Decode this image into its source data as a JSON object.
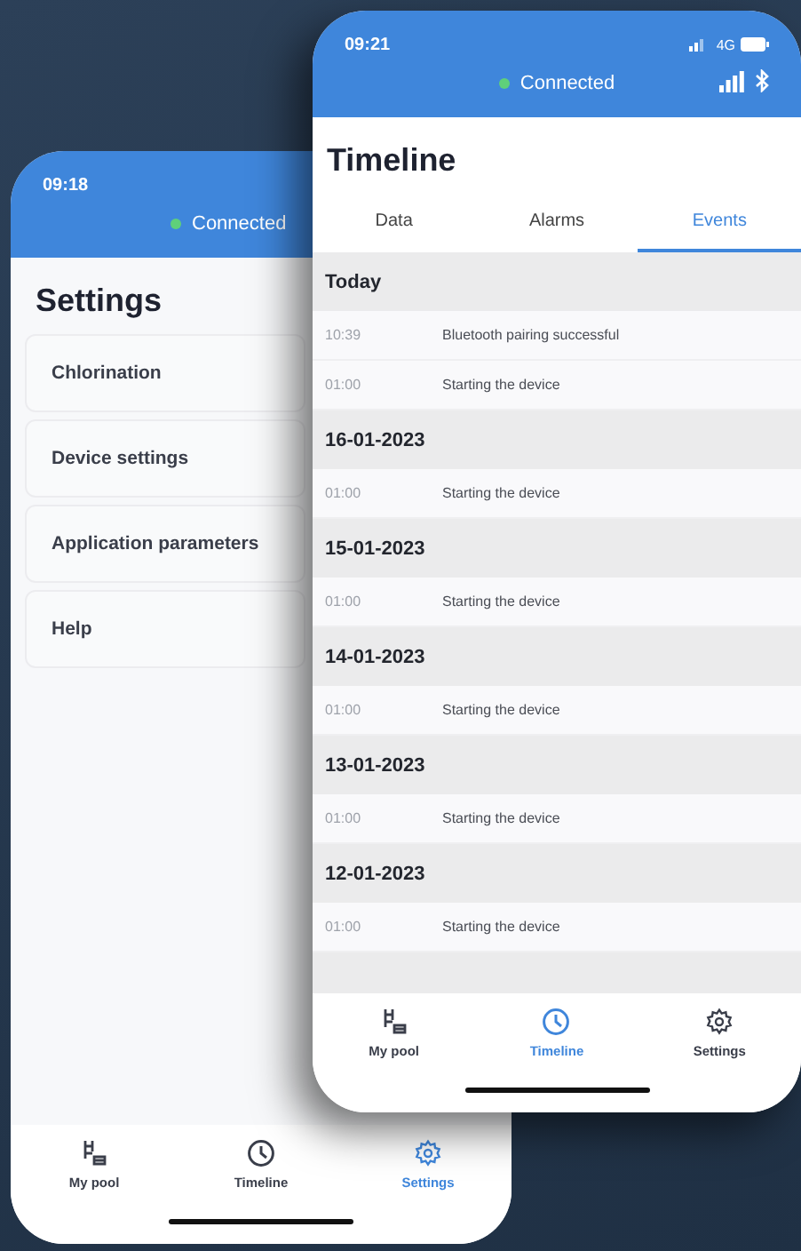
{
  "phones": [
    {
      "kind": "settings",
      "time": "09:18",
      "connection": "Connected",
      "connected": true,
      "title": "Settings",
      "items": [
        {
          "label": "Chlorination"
        },
        {
          "label": "Device settings"
        },
        {
          "label": "Application parameters"
        },
        {
          "label": "Help"
        }
      ],
      "tab_bar": [
        {
          "label": "My pool",
          "kind": "pool",
          "selected": false
        },
        {
          "label": "Timeline",
          "kind": "clock",
          "selected": false
        },
        {
          "label": "Settings",
          "kind": "gear",
          "selected": true
        }
      ]
    },
    {
      "kind": "timeline",
      "time": "09:21",
      "network": "4G",
      "connection": "Connected",
      "connected": true,
      "title": "Timeline",
      "tabs": [
        {
          "label": "Data",
          "selected": false
        },
        {
          "label": "Alarms",
          "selected": false
        },
        {
          "label": "Events",
          "selected": true
        }
      ],
      "groups": [
        {
          "date": "Today",
          "events": [
            {
              "time": "10:39",
              "text": "Bluetooth pairing successful"
            },
            {
              "time": "01:00",
              "text": "Starting the device"
            }
          ]
        },
        {
          "date": "16-01-2023",
          "events": [
            {
              "time": "01:00",
              "text": "Starting the device"
            }
          ]
        },
        {
          "date": "15-01-2023",
          "events": [
            {
              "time": "01:00",
              "text": "Starting the device"
            }
          ]
        },
        {
          "date": "14-01-2023",
          "events": [
            {
              "time": "01:00",
              "text": "Starting the device"
            }
          ]
        },
        {
          "date": "13-01-2023",
          "events": [
            {
              "time": "01:00",
              "text": "Starting the device"
            }
          ]
        },
        {
          "date": "12-01-2023",
          "events": [
            {
              "time": "01:00",
              "text": "Starting the device"
            }
          ]
        }
      ],
      "tab_bar": [
        {
          "label": "My pool",
          "kind": "pool",
          "selected": false
        },
        {
          "label": "Timeline",
          "kind": "clock",
          "selected": true
        },
        {
          "label": "Settings",
          "kind": "gear",
          "selected": false
        }
      ]
    }
  ]
}
